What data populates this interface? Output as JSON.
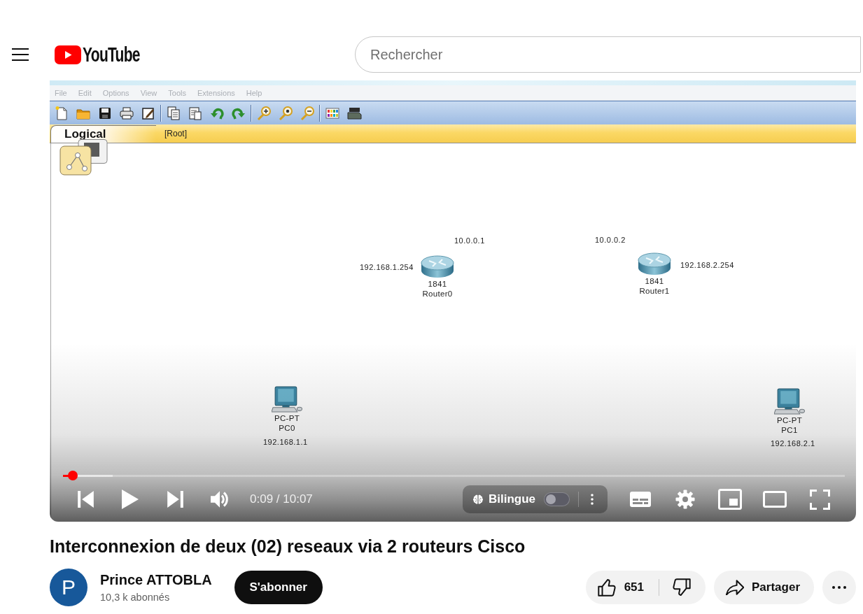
{
  "header": {
    "logo": "YouTube",
    "search": {
      "placeholder": "Rechercher"
    }
  },
  "video": {
    "app": {
      "menu": [
        "File",
        "Edit",
        "Options",
        "View",
        "Tools",
        "Extensions",
        "Help"
      ],
      "tab": {
        "label": "Logical",
        "selected": true
      },
      "path": "[Root]",
      "nodes": [
        {
          "kind": "router",
          "model": "1841",
          "name": "Router0",
          "labels": [
            "10.0.0.1",
            "192.168.1.254"
          ]
        },
        {
          "kind": "router",
          "model": "1841",
          "name": "Router1",
          "labels": [
            "10.0.0.2",
            "192.168.2.254"
          ]
        },
        {
          "kind": "pc",
          "model": "PC-PT",
          "name": "PC0",
          "labels": [
            "192.168.1.1"
          ]
        },
        {
          "kind": "pc",
          "model": "PC-PT",
          "name": "PC1",
          "labels": [
            "192.168.2.1"
          ]
        }
      ]
    },
    "player": {
      "progress": {
        "level": 0.0125,
        "buffered": {
          "level": 0.064
        }
      },
      "playing": false,
      "time": "0:09 / 10:07",
      "language": {
        "label": "Bilingue",
        "on": false
      }
    }
  },
  "title": "Interconnexion de deux (02) reseaux via 2 routeurs Cisco",
  "channel": {
    "avatar": "P",
    "name": "Prince ATTOBLA",
    "subscribers": "10,3 k abonnés",
    "subscribe": "S'abonner"
  },
  "actions": {
    "likes": "651",
    "share": "Partager"
  }
}
